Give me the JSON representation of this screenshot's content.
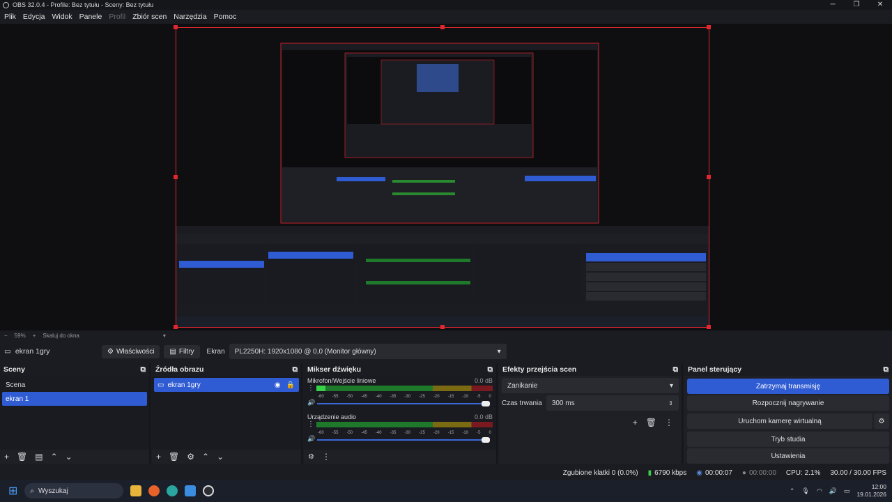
{
  "window": {
    "title": "OBS 32.0.4 - Profile: Bez tytułu - Sceny: Bez tytułu",
    "controls": [
      "─",
      "❐",
      "✕"
    ]
  },
  "menu": [
    "Plik",
    "Edycja",
    "Widok",
    "Panele",
    "Profil",
    "Zbiór scen",
    "Narzędzia",
    "Pomoc"
  ],
  "zoom": {
    "minus": "−",
    "value": "59%",
    "plus": "+",
    "scale_label": "Skaluj do okna"
  },
  "source_bar": {
    "current_source": "ekran 1gry",
    "properties": "Właściwości",
    "filters": "Filtry",
    "screen_label": "Ekran",
    "screen_value": "PL2250H: 1920x1080 @ 0,0 (Monitor główny)"
  },
  "scenes": {
    "title": "Sceny",
    "items": [
      "Scena",
      "ekran 1"
    ],
    "selected": 1
  },
  "sources": {
    "title": "Źródła obrazu",
    "items": [
      "ekran 1gry"
    ]
  },
  "mixer": {
    "title": "Mikser dźwięku",
    "ticks": [
      "-60",
      "-55",
      "-50",
      "-45",
      "-40",
      "-35",
      "-30",
      "-25",
      "-20",
      "-15",
      "-10",
      "-5",
      "0"
    ],
    "channels": [
      {
        "name": "Mikrofon/Wejście liniowe",
        "db": "0.0 dB",
        "level": 0.05
      },
      {
        "name": "Urządzenie audio",
        "db": "0.0 dB",
        "level": 0.0
      }
    ]
  },
  "transitions": {
    "title": "Efekty przejścia scen",
    "type": "Zanikanie",
    "duration_label": "Czas trwania",
    "duration_value": "300 ms"
  },
  "controls": {
    "title": "Panel sterujący",
    "buttons": [
      "Zatrzymaj transmisję",
      "Rozpocznij nagrywanie",
      "Uruchom kamerę wirtualną",
      "Tryb studia",
      "Ustawienia"
    ]
  },
  "status": {
    "dropped": "Zgubione klatki 0 (0.0%)",
    "bitrate": "6790 kbps",
    "stream_time": "00:00:07",
    "rec_time": "00:00:00",
    "cpu": "CPU: 2.1%",
    "fps": "30.00 / 30.00 FPS"
  },
  "taskbar": {
    "search": "Wyszukaj",
    "time": "12:00",
    "date": "19.01.2026"
  },
  "colors": {
    "accent": "#2f5bd3",
    "selection_border": "#e0262f",
    "meter_green": "#39d14a"
  }
}
